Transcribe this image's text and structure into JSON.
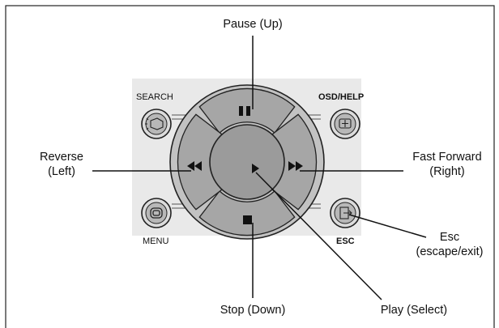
{
  "labels": {
    "pause": "Pause (Up)",
    "reverse_1": "Reverse",
    "reverse_2": "(Left)",
    "fast_forward_1": "Fast Forward",
    "fast_forward_2": "(Right)",
    "esc_1": "Esc",
    "esc_2": "(escape/exit)",
    "stop": "Stop (Down)",
    "play": "Play (Select)"
  },
  "buttons": {
    "search": "SEARCH",
    "osd_help": "OSD/HELP",
    "menu": "MENU",
    "esc": "ESC"
  },
  "icons": {
    "up": "pause-icon",
    "down": "stop-icon",
    "left": "rewind-icon",
    "right": "fast-forward-icon",
    "center": "play-icon",
    "search": "flashlight-icon",
    "osd_help": "help-screen-icon",
    "menu": "menu-icon",
    "esc": "exit-icon"
  },
  "colors": {
    "panel": "#e9e9e9",
    "ring": "#c2c2c2",
    "button_face": "#a6a6a6",
    "center_face": "#9b9b9b",
    "outline": "#222222"
  }
}
